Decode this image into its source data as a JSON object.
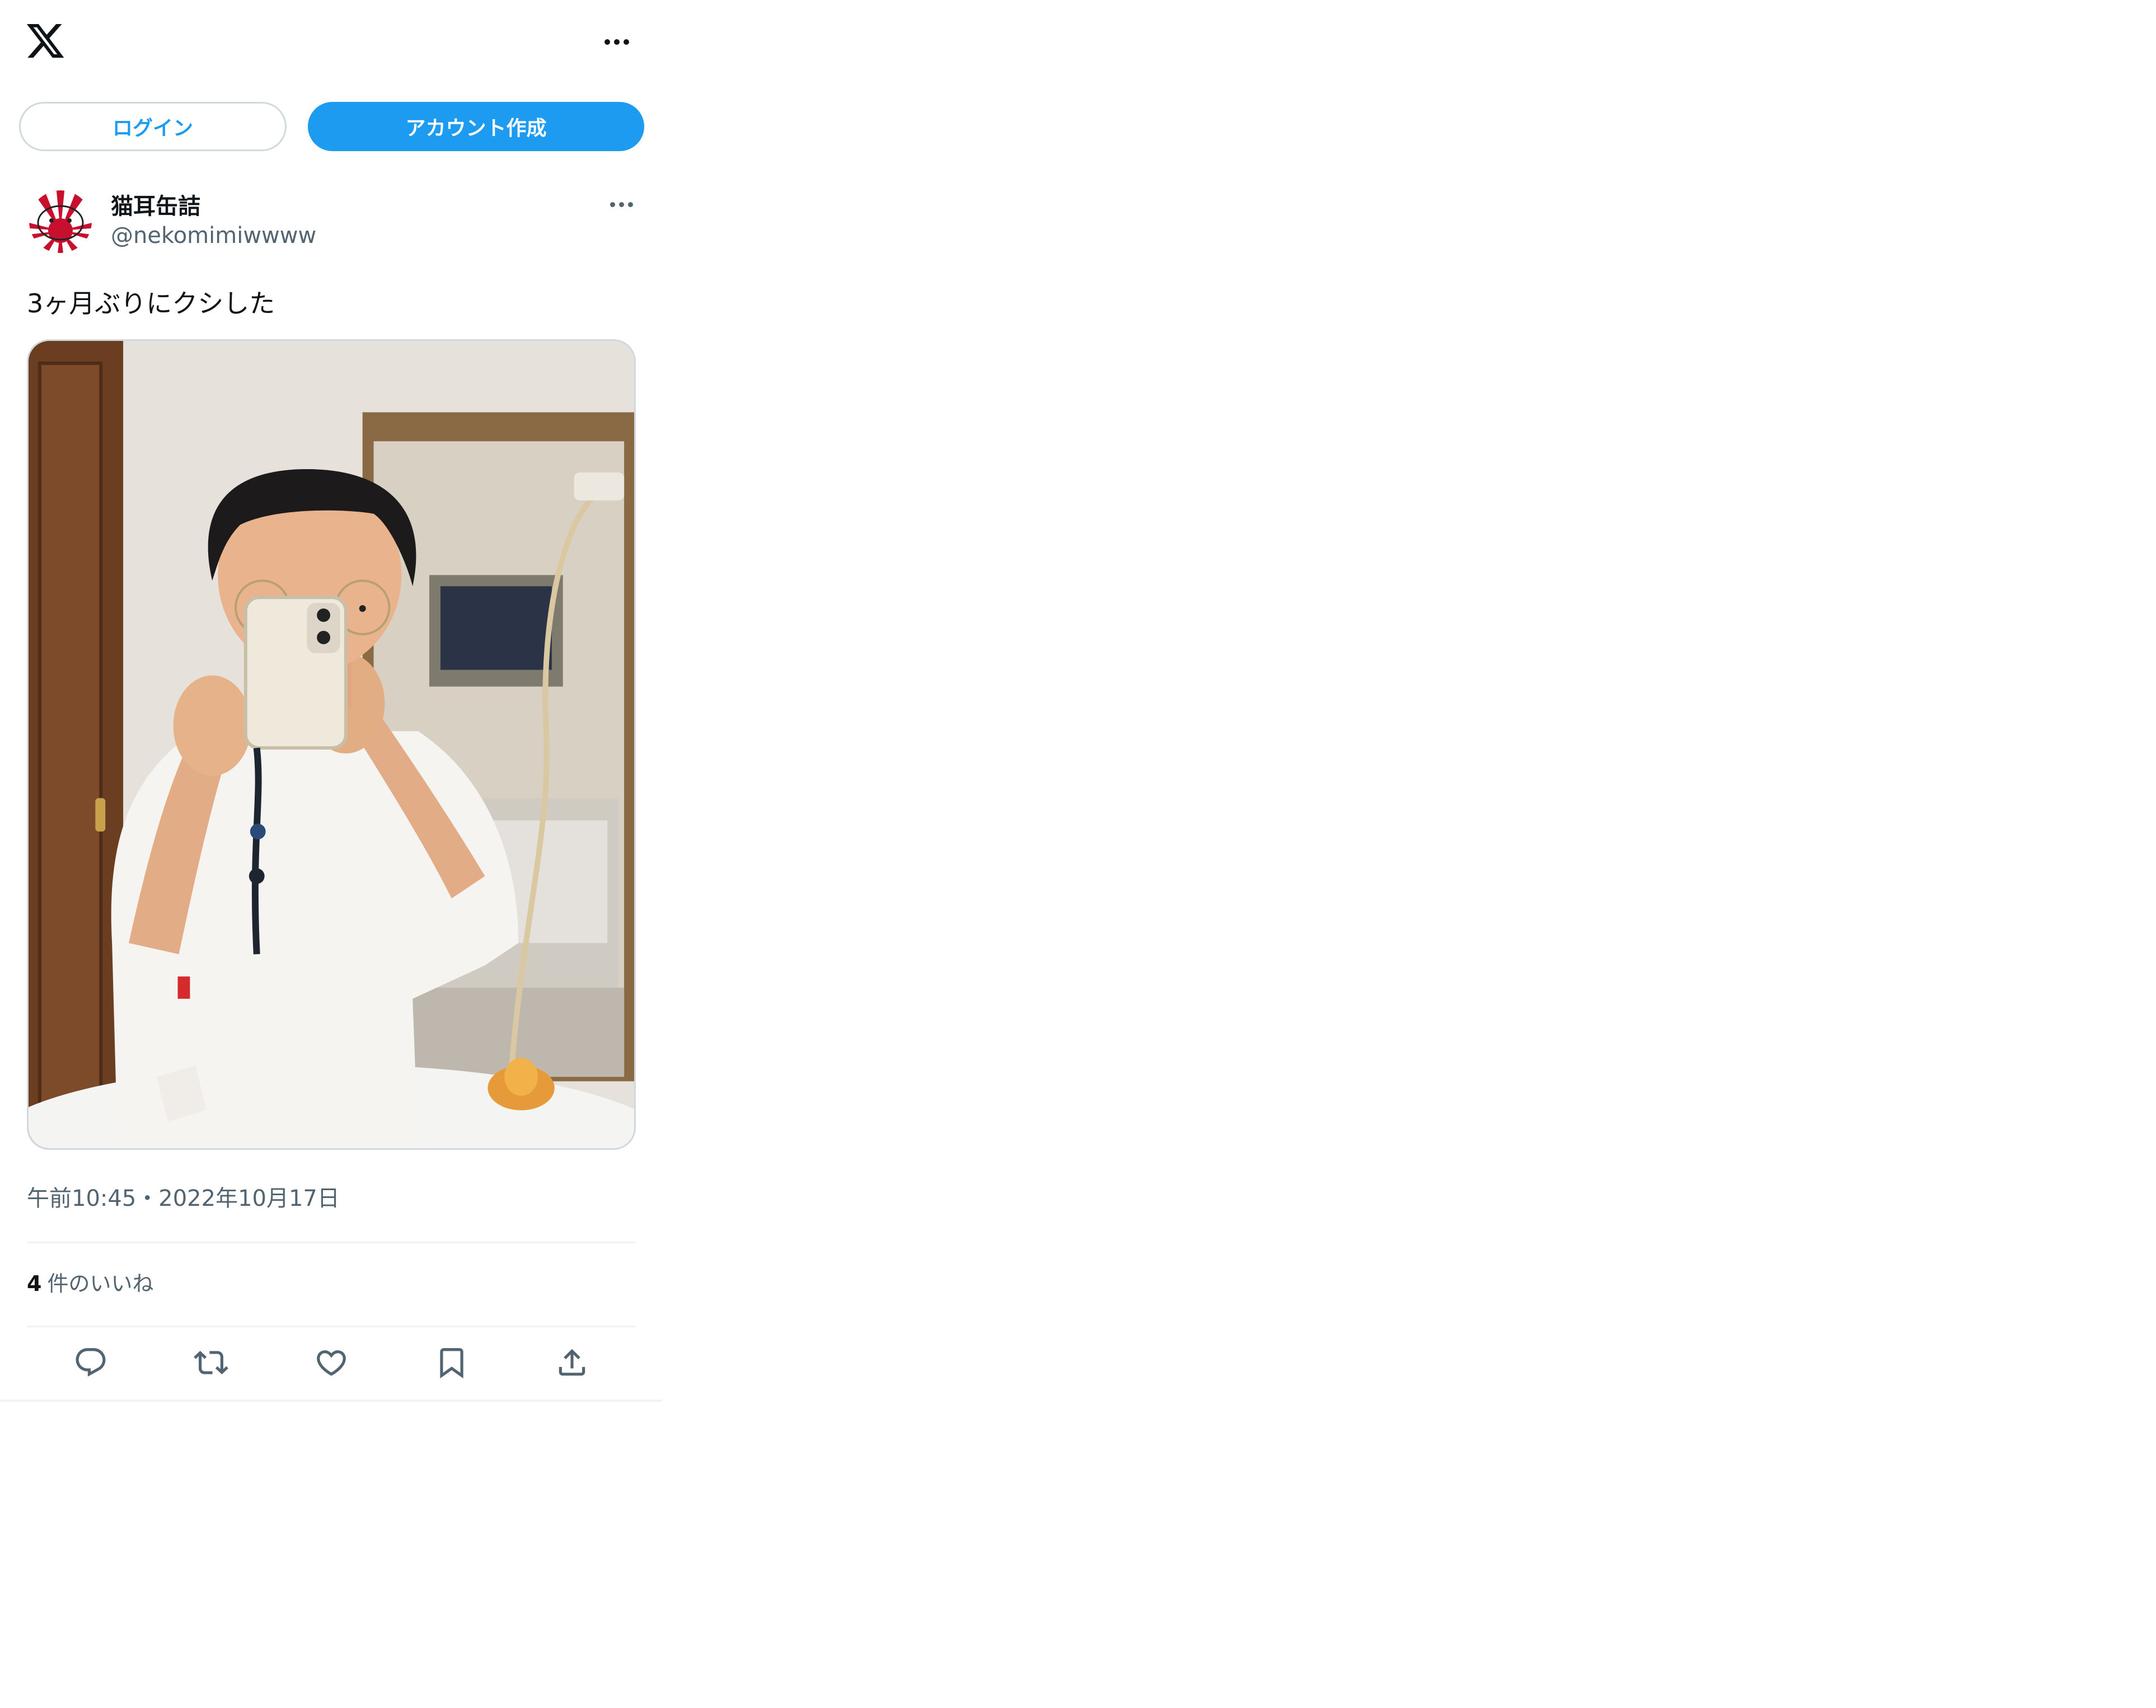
{
  "header": {
    "logo_icon": "x-logo-icon",
    "more_icon": "more-horizontal-icon"
  },
  "auth": {
    "login_label": "ログイン",
    "signup_label": "アカウント作成"
  },
  "colors": {
    "accent": "#1d9bf0",
    "text_primary": "#0f1419",
    "text_secondary": "#536471",
    "border": "#cfd9de",
    "divider": "#eff3f4"
  },
  "post": {
    "author": {
      "display_name": "猫耳缶詰",
      "handle": "@nekomimiwwww",
      "avatar_icon": "rising-sun-avatar"
    },
    "text": "3ヶ月ぶりにクシした",
    "media_description_icon": "mirror-selfie-photo",
    "timestamp": "午前10:45・2022年10月17日",
    "likes_count": "4",
    "likes_label": "件のいいね"
  },
  "actions": [
    {
      "name": "reply",
      "icon": "reply-icon"
    },
    {
      "name": "repost",
      "icon": "repost-icon"
    },
    {
      "name": "like",
      "icon": "heart-icon"
    },
    {
      "name": "bookmark",
      "icon": "bookmark-icon"
    },
    {
      "name": "share",
      "icon": "share-icon"
    }
  ]
}
